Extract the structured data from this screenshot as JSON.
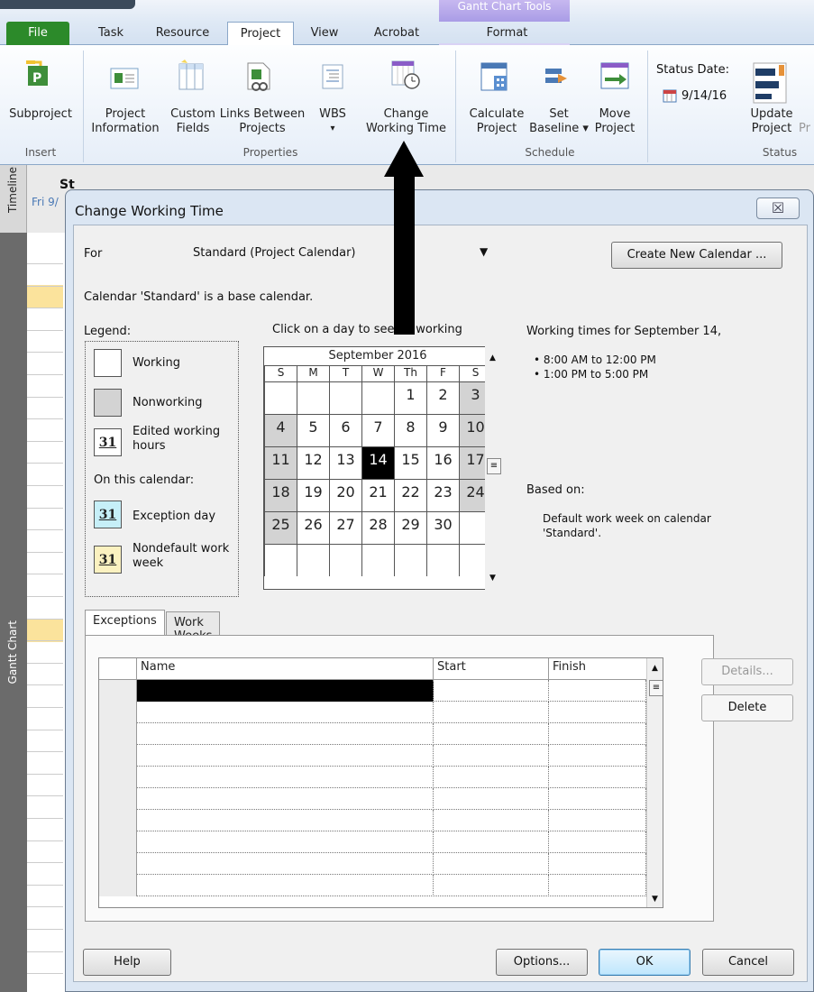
{
  "ribbon": {
    "tabs": [
      {
        "label": "File"
      },
      {
        "label": "Task"
      },
      {
        "label": "Resource"
      },
      {
        "label": "Project"
      },
      {
        "label": "View"
      },
      {
        "label": "Acrobat"
      },
      {
        "label": "Format"
      }
    ],
    "context_title": "Gantt Chart Tools",
    "buttons": {
      "subproject": "Subproject",
      "project_info_1": "Project",
      "project_info_2": "Information",
      "custom_fields_1": "Custom",
      "custom_fields_2": "Fields",
      "links_1": "Links Between",
      "links_2": "Projects",
      "wbs_1": "WBS",
      "wbs_2": "▾",
      "cwt_1": "Change",
      "cwt_2": "Working Time",
      "calc_1": "Calculate",
      "calc_2": "Project",
      "baseline_1": "Set",
      "baseline_2": "Baseline ▾",
      "move_1": "Move",
      "move_2": "Project",
      "status_date_label": "Status Date:",
      "status_date_value": "9/14/16",
      "update_1": "Update",
      "update_2": "Project",
      "update_cut": "Pr"
    },
    "groups": {
      "insert": "Insert",
      "properties": "Properties",
      "schedule": "Schedule",
      "status": "Status"
    }
  },
  "app": {
    "timeline_label": "Timeline",
    "gantt_label": "Gantt Chart",
    "timeline_start": "St",
    "timeline_date": "Fri 9/"
  },
  "dialog": {
    "title": "Change Working Time",
    "close": "☒",
    "for_label": "For",
    "calendar_select": "Standard (Project Calendar)",
    "create_new": "Create New Calendar ...",
    "base_note": "Calendar 'Standard' is a base calendar.",
    "legend_title": "Legend:",
    "legend": {
      "working": "Working",
      "nonworking": "Nonworking",
      "edited_1": "Edited working",
      "edited_2": "hours",
      "on_calendar": "On this calendar:",
      "exception": "Exception day",
      "nondefault_1": "Nondefault work",
      "nondefault_2": "week",
      "swatch_num": "31"
    },
    "click_hint": "Click on a day to see its working",
    "calendar": {
      "month": "September 2016",
      "dow": [
        "S",
        "M",
        "T",
        "W",
        "Th",
        "F",
        "S"
      ],
      "weeks": [
        [
          "",
          "",
          "",
          "",
          "1",
          "2",
          "3"
        ],
        [
          "4",
          "5",
          "6",
          "7",
          "8",
          "9",
          "10"
        ],
        [
          "11",
          "12",
          "13",
          "14",
          "15",
          "16",
          "17"
        ],
        [
          "18",
          "19",
          "20",
          "21",
          "22",
          "23",
          "24"
        ],
        [
          "25",
          "26",
          "27",
          "28",
          "29",
          "30",
          ""
        ],
        [
          "",
          "",
          "",
          "",
          "",
          "",
          ""
        ]
      ],
      "selected": "14"
    },
    "working_times_title": "Working times for September 14,",
    "working_times": [
      "• 8:00 AM to 12:00 PM",
      "• 1:00 PM to 5:00 PM"
    ],
    "based_on": "Based on:",
    "based_on_text_1": "Default work week on calendar",
    "based_on_text_2": "'Standard'.",
    "tabs": [
      "Exceptions",
      "Work Weeks"
    ],
    "table": {
      "columns": [
        "Name",
        "Start",
        "Finish"
      ],
      "rows": 10
    },
    "details": "Details...",
    "delete": "Delete",
    "help": "Help",
    "options": "Options...",
    "ok": "OK",
    "cancel": "Cancel"
  },
  "colors": {
    "file_tab": "#2c8a2a",
    "nonworking": "#d3d3d3",
    "exception": "#c6eff8",
    "nondefault": "#fbf1c0",
    "selected_day": "#000000"
  }
}
